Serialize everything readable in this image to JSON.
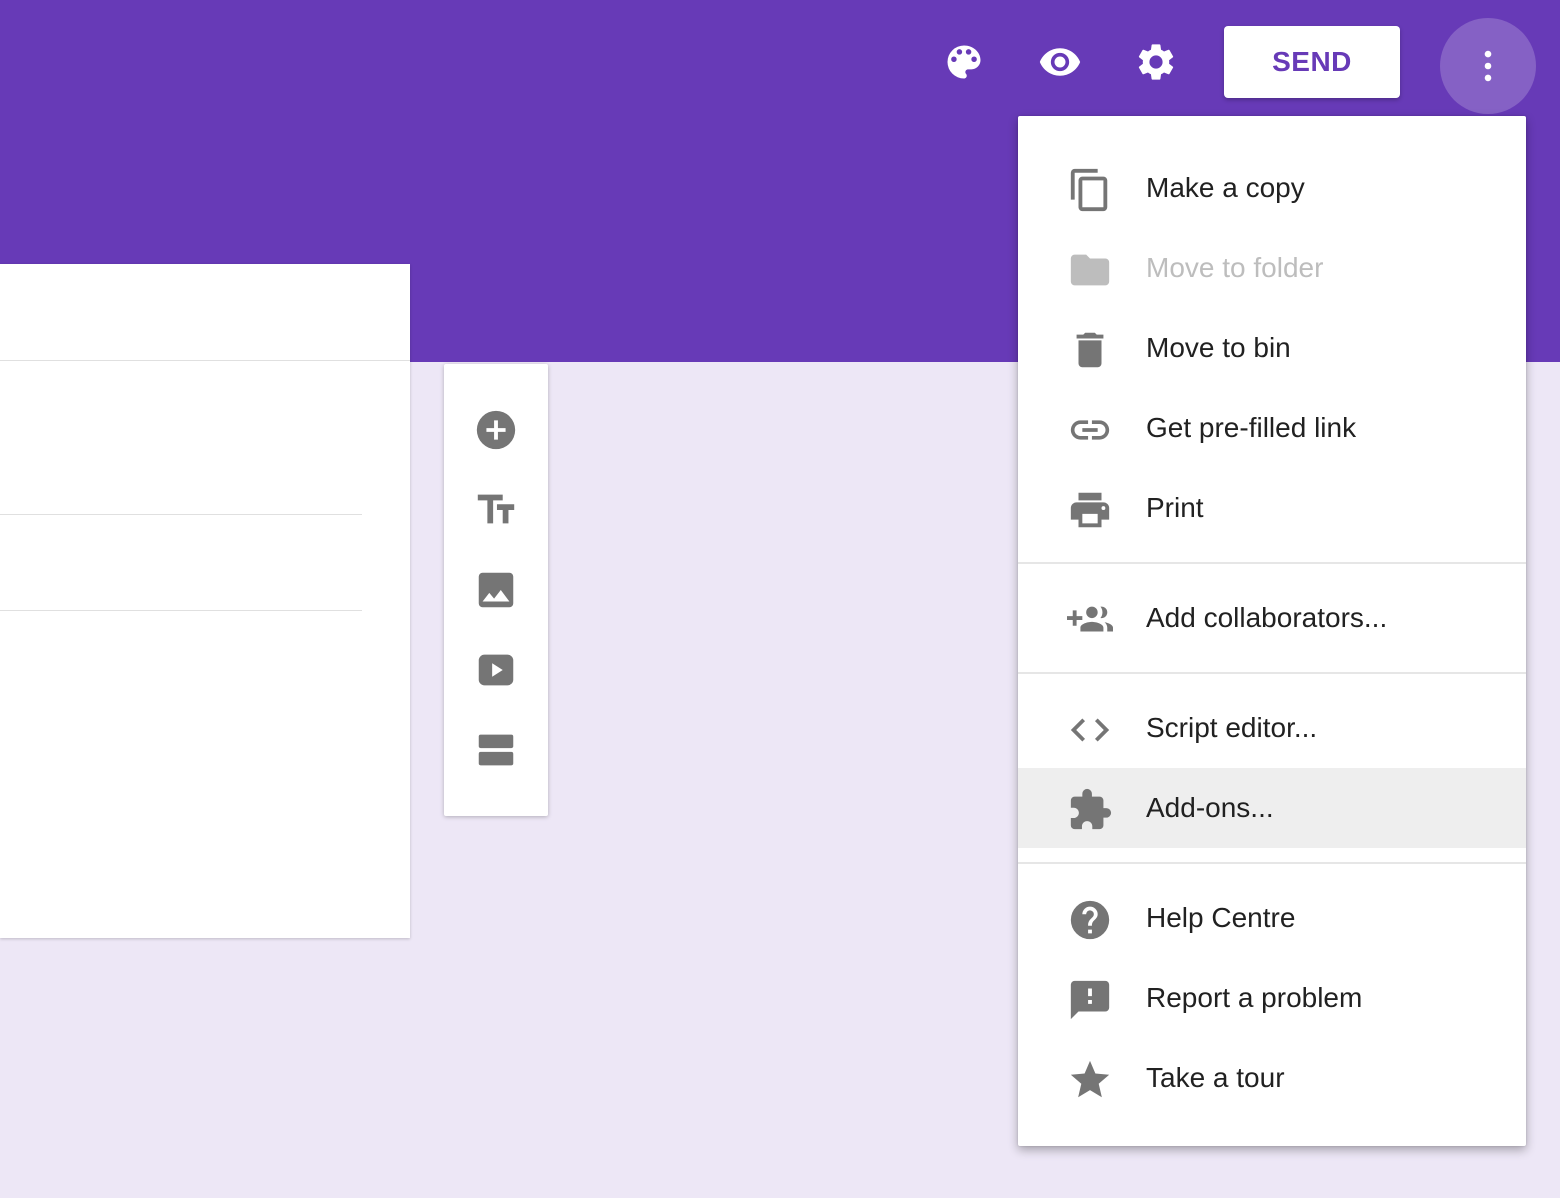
{
  "header": {
    "accent_color": "#673ab7",
    "icons": [
      "palette-icon",
      "eye-icon",
      "gear-icon"
    ],
    "send_label": "SEND",
    "more_icon": "more-vert-icon"
  },
  "toolbar": {
    "tools": [
      "add-circle-icon",
      "title-text-icon",
      "image-icon",
      "video-icon",
      "section-icon"
    ]
  },
  "menu": {
    "items": [
      {
        "label": "Make a copy",
        "icon": "copy-icon",
        "enabled": true
      },
      {
        "label": "Move to folder",
        "icon": "folder-icon",
        "enabled": false
      },
      {
        "label": "Move to bin",
        "icon": "trash-icon",
        "enabled": true
      },
      {
        "label": "Get pre-filled link",
        "icon": "link-icon",
        "enabled": true
      },
      {
        "label": "Print",
        "icon": "print-icon",
        "enabled": true
      },
      {
        "label": "Add collaborators...",
        "icon": "add-people-icon",
        "enabled": true
      },
      {
        "label": "Script editor...",
        "icon": "code-icon",
        "enabled": true
      },
      {
        "label": "Add-ons...",
        "icon": "puzzle-icon",
        "enabled": true,
        "highlighted": true
      },
      {
        "label": "Help Centre",
        "icon": "help-icon",
        "enabled": true
      },
      {
        "label": "Report a problem",
        "icon": "feedback-icon",
        "enabled": true
      },
      {
        "label": "Take a tour",
        "icon": "star-icon",
        "enabled": true
      }
    ]
  }
}
